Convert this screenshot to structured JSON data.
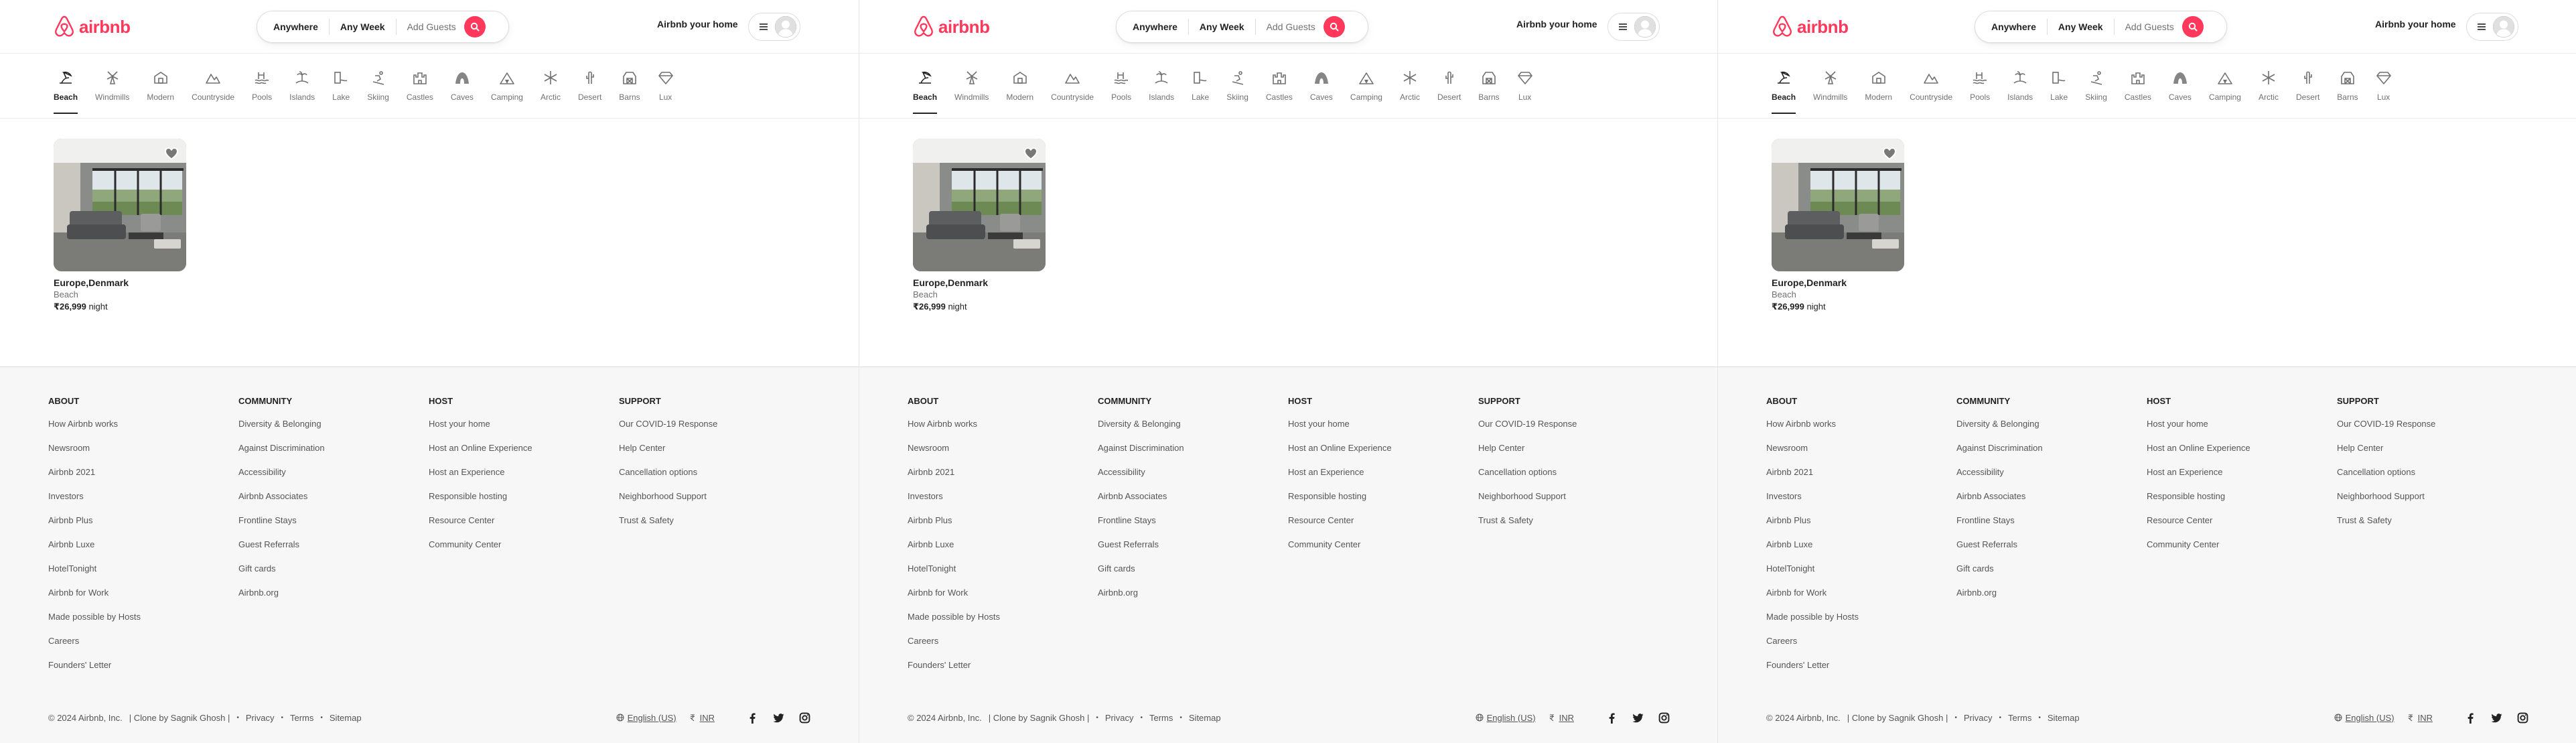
{
  "brand": {
    "name": "airbnb",
    "color": "#ff385c"
  },
  "search": {
    "anywhere": "Anywhere",
    "any_week": "Any Week",
    "add_guests": "Add Guests"
  },
  "header": {
    "host_link": "Airbnb your home"
  },
  "categories": [
    {
      "label": "Beach",
      "icon": "beach-icon",
      "active": true
    },
    {
      "label": "Windmills",
      "icon": "windmill-icon",
      "active": false
    },
    {
      "label": "Modern",
      "icon": "modern-house-icon",
      "active": false
    },
    {
      "label": "Countryside",
      "icon": "countryside-icon",
      "active": false
    },
    {
      "label": "Pools",
      "icon": "pool-icon",
      "active": false
    },
    {
      "label": "Islands",
      "icon": "island-icon",
      "active": false
    },
    {
      "label": "Lake",
      "icon": "lake-icon",
      "active": false
    },
    {
      "label": "Skiing",
      "icon": "skiing-icon",
      "active": false
    },
    {
      "label": "Castles",
      "icon": "castle-icon",
      "active": false
    },
    {
      "label": "Caves",
      "icon": "cave-icon",
      "active": false
    },
    {
      "label": "Camping",
      "icon": "camping-icon",
      "active": false
    },
    {
      "label": "Arctic",
      "icon": "arctic-icon",
      "active": false
    },
    {
      "label": "Desert",
      "icon": "desert-icon",
      "active": false
    },
    {
      "label": "Barns",
      "icon": "barn-icon",
      "active": false
    },
    {
      "label": "Lux",
      "icon": "diamond-icon",
      "active": false
    }
  ],
  "listing": {
    "location": "Europe,Denmark",
    "category": "Beach",
    "price": "₹26,999",
    "price_unit": "night"
  },
  "footer": {
    "columns": [
      {
        "heading": "ABOUT",
        "links": [
          "How Airbnb works",
          "Newsroom",
          "Airbnb 2021",
          "Investors",
          "Airbnb Plus",
          "Airbnb Luxe",
          "HotelTonight",
          "Airbnb for Work",
          "Made possible by Hosts",
          "Careers",
          "Founders' Letter"
        ]
      },
      {
        "heading": "COMMUNITY",
        "links": [
          "Diversity & Belonging",
          "Against Discrimination",
          "Accessibility",
          "Airbnb Associates",
          "Frontline Stays",
          "Guest Referrals",
          "Gift cards",
          "Airbnb.org"
        ]
      },
      {
        "heading": "HOST",
        "links": [
          "Host your home",
          "Host an Online Experience",
          "Host an Experience",
          "Responsible hosting",
          "Resource Center",
          "Community Center"
        ]
      },
      {
        "heading": "SUPPORT",
        "links": [
          "Our COVID-19 Response",
          "Help Center",
          "Cancellation options",
          "Neighborhood Support",
          "Trust & Safety"
        ]
      }
    ],
    "copyright": "© 2024 Airbnb, Inc.",
    "clone": "| Clone by Sagnik Ghosh |",
    "privacy": "Privacy",
    "terms": "Terms",
    "sitemap": "Sitemap",
    "language": "English (US)",
    "currency": "INR",
    "social": [
      "facebook-icon",
      "twitter-icon",
      "instagram-icon"
    ]
  },
  "panes": 3
}
